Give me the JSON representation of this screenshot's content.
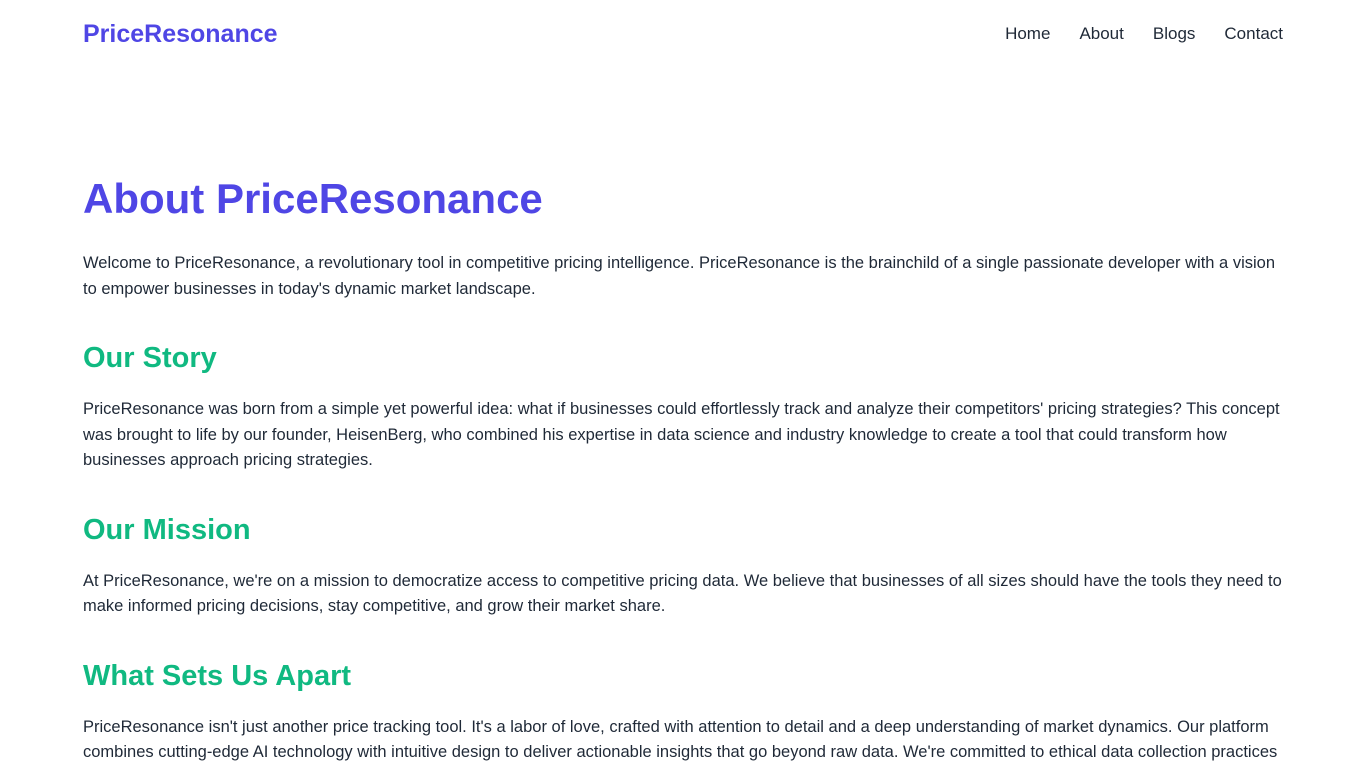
{
  "header": {
    "logo": "PriceResonance",
    "nav": [
      "Home",
      "About",
      "Blogs",
      "Contact"
    ]
  },
  "main": {
    "title": "About PriceResonance",
    "intro": "Welcome to PriceResonance, a revolutionary tool in competitive pricing intelligence. PriceResonance is the brainchild of a single passionate developer with a vision to empower businesses in today's dynamic market landscape.",
    "sections": [
      {
        "heading": "Our Story",
        "text": "PriceResonance was born from a simple yet powerful idea: what if businesses could effortlessly track and analyze their competitors' pricing strategies? This concept was brought to life by our founder, HeisenBerg, who combined his expertise in data science and industry knowledge to create a tool that could transform how businesses approach pricing strategies."
      },
      {
        "heading": "Our Mission",
        "text": "At PriceResonance, we're on a mission to democratize access to competitive pricing data. We believe that businesses of all sizes should have the tools they need to make informed pricing decisions, stay competitive, and grow their market share."
      },
      {
        "heading": "What Sets Us Apart",
        "text": "PriceResonance isn't just another price tracking tool. It's a labor of love, crafted with attention to detail and a deep understanding of market dynamics. Our platform combines cutting-edge AI technology with intuitive design to deliver actionable insights that go beyond raw data. We're committed to ethical data collection practices and continuously improve our tool based on user feedback."
      }
    ]
  },
  "colors": {
    "brand": "#4f46e5",
    "section_heading": "#10b981",
    "text": "#1f2937",
    "background": "#ffffff"
  }
}
